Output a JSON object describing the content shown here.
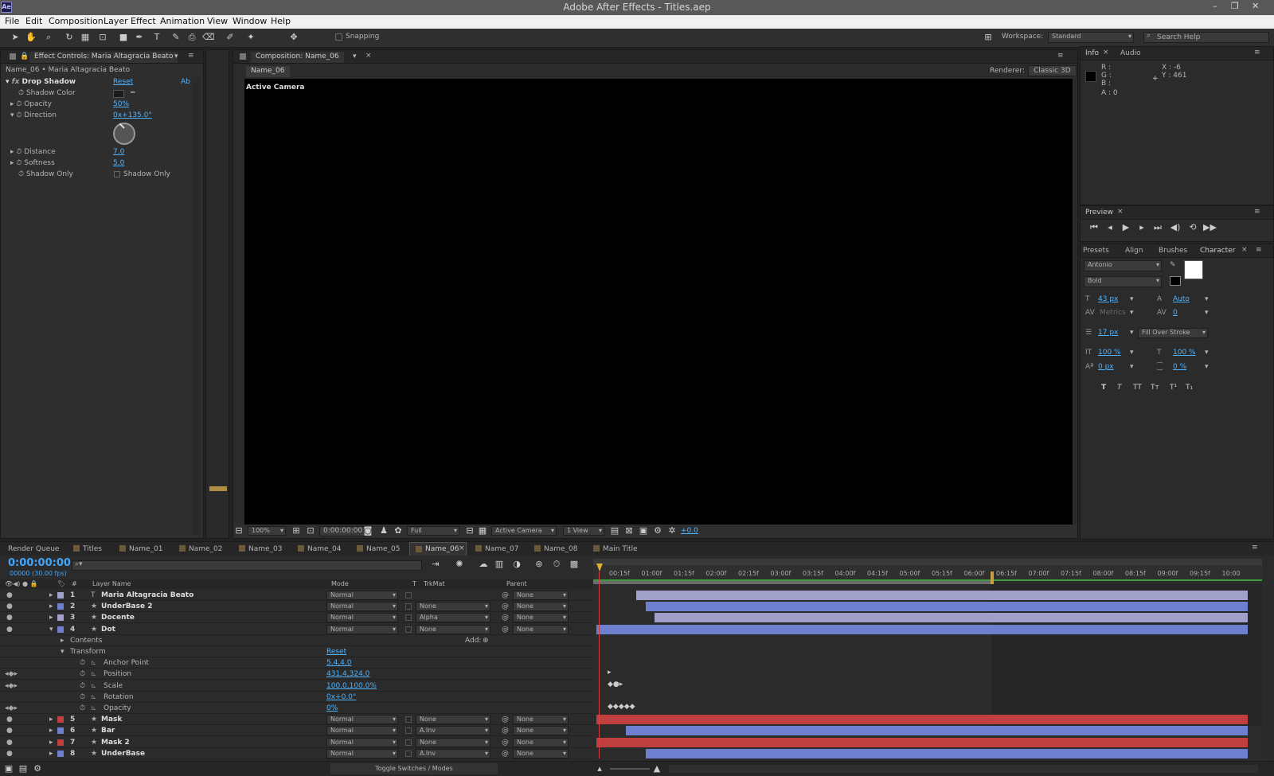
{
  "app": {
    "title": "Adobe After Effects - Titles.aep",
    "icon": "Ae"
  },
  "menu": [
    "File",
    "Edit",
    "Composition",
    "Layer",
    "Effect",
    "Animation",
    "View",
    "Window",
    "Help"
  ],
  "toolbar": {
    "snapping": "Snapping",
    "workspace_label": "Workspace:",
    "workspace": "Standard",
    "search_placeholder": "Search Help"
  },
  "effect_controls": {
    "tab": "Effect Controls: Maria Altagracia Beato",
    "path": "Name_06 • Maria Altagracia Beato",
    "effect": "Drop Shadow",
    "reset": "Reset",
    "about": "Ab",
    "props": [
      {
        "name": "Shadow Color",
        "value": ""
      },
      {
        "name": "Opacity",
        "value": "50%"
      },
      {
        "name": "Direction",
        "value": "0x+135.0°"
      },
      {
        "name": "Distance",
        "value": "7.0"
      },
      {
        "name": "Softness",
        "value": "5.0"
      },
      {
        "name": "Shadow Only",
        "value": "Shadow Only"
      }
    ]
  },
  "composition": {
    "tab": "Composition: Name_06",
    "subtab": "Name_06",
    "renderer_label": "Renderer:",
    "renderer": "Classic 3D",
    "view_label": "Active Camera",
    "footer": {
      "zoom": "100%",
      "time": "0:00:00:00",
      "resolution": "Full",
      "camera": "Active Camera",
      "views": "1 View",
      "exposure": "+0.0"
    }
  },
  "info": {
    "tab1": "Info",
    "tab2": "Audio",
    "r": "R :",
    "g": "G :",
    "b": "B :",
    "a": "A : 0",
    "x": "X : -6",
    "y": "Y : 461"
  },
  "preview": {
    "tab": "Preview"
  },
  "character": {
    "tabs": [
      "Presets",
      "Align",
      "Brushes",
      "Character"
    ],
    "font": "Antonio",
    "style": "Bold",
    "size": "43 px",
    "leading": "Auto",
    "kerning": "Metrics",
    "tracking": "0",
    "stroke_width": "17 px",
    "stroke_mode": "Fill Over Stroke",
    "vscale": "100 %",
    "hscale": "100 %",
    "baseline": "0 px",
    "tsume": "0 %",
    "styles": [
      "T",
      "T",
      "TT",
      "Tт",
      "T¹",
      "T₁"
    ]
  },
  "timeline": {
    "tabs": [
      "Render Queue",
      "Titles",
      "Name_01",
      "Name_02",
      "Name_03",
      "Name_04",
      "Name_05",
      "Name_06",
      "Name_07",
      "Name_08",
      "Main Title"
    ],
    "active_tab": "Name_06",
    "timecode": "0:00:00:00",
    "fps": "00000 (30.00 fps)",
    "headers": {
      "num": "#",
      "name": "Layer Name",
      "mode": "Mode",
      "t": "T",
      "trkmat": "TrkMat",
      "parent": "Parent"
    },
    "ruler": [
      "00:15f",
      "01:00f",
      "01:15f",
      "02:00f",
      "02:15f",
      "03:00f",
      "03:15f",
      "04:00f",
      "04:15f",
      "05:00f",
      "05:15f",
      "06:00f",
      "06:15f",
      "07:00f",
      "07:15f",
      "08:00f",
      "08:15f",
      "09:00f",
      "09:15f",
      "10:00"
    ],
    "layers": [
      {
        "num": "1",
        "name": "Maria Altagracia Beato",
        "mode": "Normal",
        "trkmat": "",
        "parent": "None",
        "color": "#a0a0c8"
      },
      {
        "num": "2",
        "name": "UnderBase 2",
        "mode": "Normal",
        "trkmat": "None",
        "parent": "None",
        "color": "#6f7fd0"
      },
      {
        "num": "3",
        "name": "Docente",
        "mode": "Normal",
        "trkmat": "Alpha",
        "parent": "None",
        "color": "#a0a0c8"
      },
      {
        "num": "4",
        "name": "Dot",
        "mode": "Normal",
        "trkmat": "None",
        "parent": "None",
        "color": "#6f7fd0"
      },
      {
        "num": "5",
        "name": "Mask",
        "mode": "Normal",
        "trkmat": "None",
        "parent": "None",
        "color": "#c04040"
      },
      {
        "num": "6",
        "name": "Bar",
        "mode": "Normal",
        "trkmat": "A.Inv",
        "parent": "None",
        "color": "#6f7fd0"
      },
      {
        "num": "7",
        "name": "Mask 2",
        "mode": "Normal",
        "trkmat": "None",
        "parent": "None",
        "color": "#c04040"
      },
      {
        "num": "8",
        "name": "UnderBase",
        "mode": "Normal",
        "trkmat": "A.Inv",
        "parent": "None",
        "color": "#6f7fd0"
      }
    ],
    "contents": "Contents",
    "add": "Add:",
    "transform": "Transform",
    "transform_reset": "Reset",
    "transform_props": [
      {
        "name": "Anchor Point",
        "value": "5.4,4.0"
      },
      {
        "name": "Position",
        "value": "431.4,324.0"
      },
      {
        "name": "Scale",
        "value": "100.0,100.0%"
      },
      {
        "name": "Rotation",
        "value": "0x+0.0°"
      },
      {
        "name": "Opacity",
        "value": "0%"
      }
    ],
    "toggle": "Toggle Switches / Modes"
  }
}
